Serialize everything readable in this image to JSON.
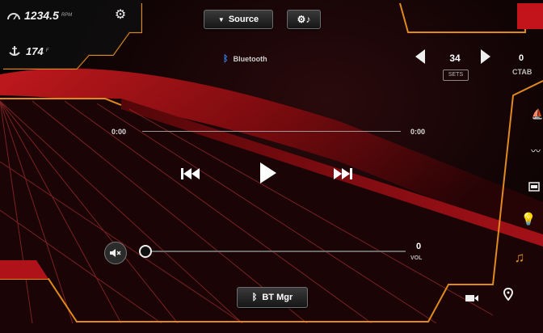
{
  "status": {
    "rpm_value": "1234.5",
    "rpm_unit": "RPM",
    "depth_value": "174",
    "depth_unit": "F"
  },
  "toolbar": {
    "source_label": "Source"
  },
  "audio": {
    "source_name": "Bluetooth",
    "elapsed": "0:00",
    "duration": "0:00",
    "progress": 0,
    "volume": "0",
    "volume_label": "VOL",
    "bt_button_label": "BT Mgr"
  },
  "ballast": {
    "value": "34",
    "label": "SETS",
    "next_value": "0",
    "next_label": "CTAB"
  },
  "colors": {
    "accent": "#e08a1e",
    "red_glow": "#c2141a",
    "button_bg": "#262626"
  }
}
